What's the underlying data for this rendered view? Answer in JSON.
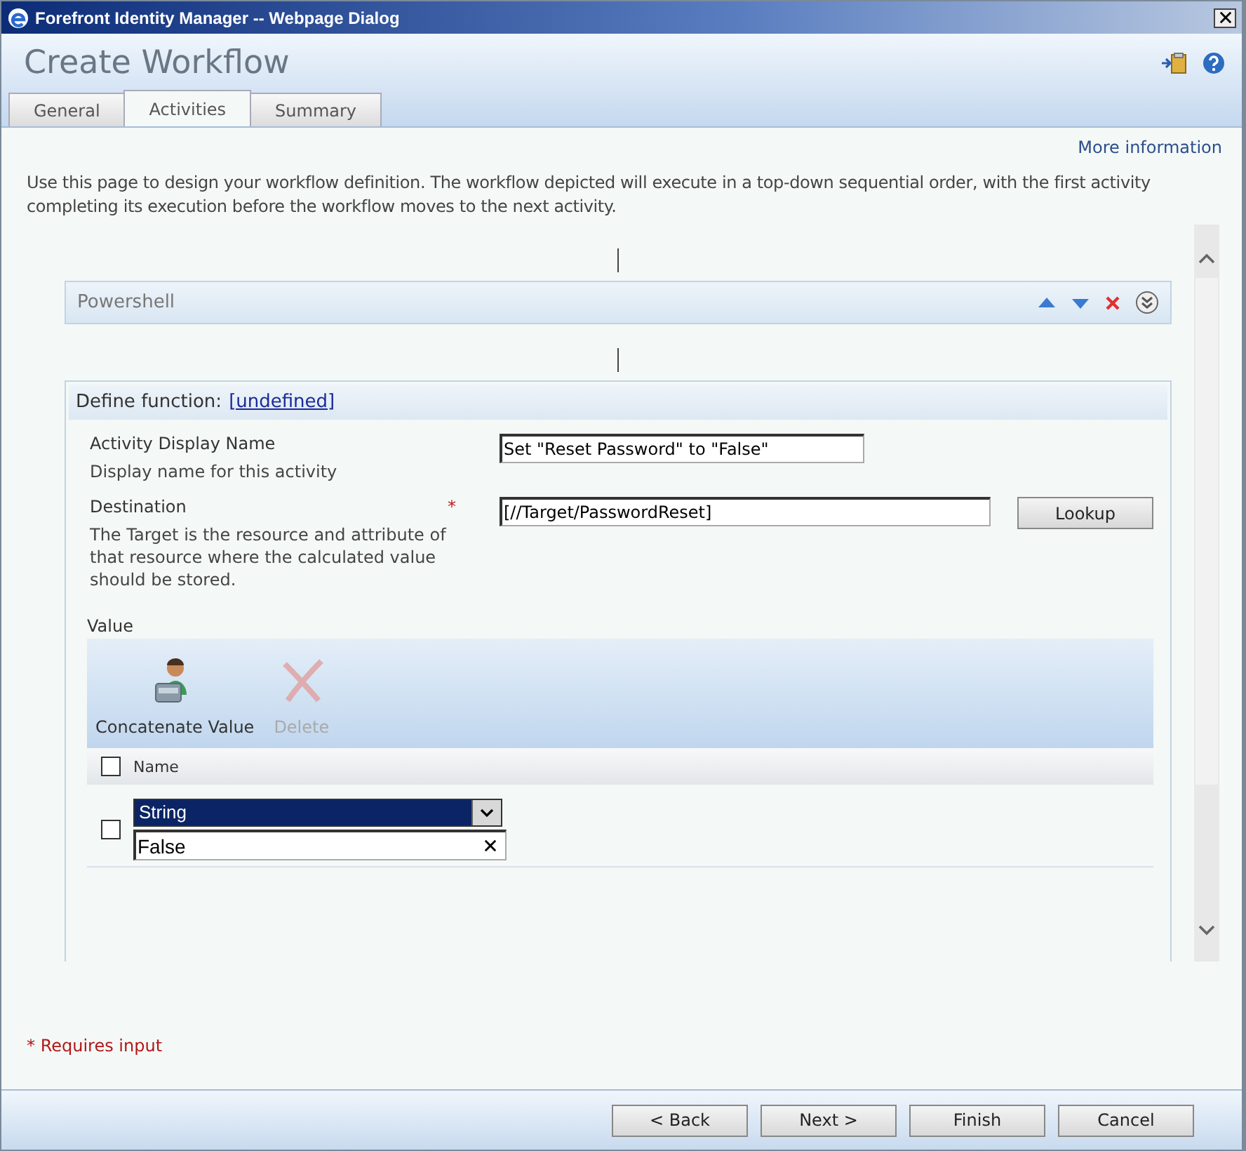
{
  "window": {
    "title": "Forefront Identity Manager -- Webpage Dialog"
  },
  "header": {
    "title": "Create Workflow"
  },
  "tabs": [
    {
      "label": "General",
      "selected": false
    },
    {
      "label": "Activities",
      "selected": true
    },
    {
      "label": "Summary",
      "selected": false
    }
  ],
  "more_info_link": "More information",
  "intro": "Use this page to design your workflow definition. The workflow depicted will execute in a top-down sequential order, with the first activity completing its execution before the workflow moves to the next activity.",
  "activity": {
    "title": "Powershell"
  },
  "define": {
    "label": "Define function:",
    "link": "[undefined]"
  },
  "fields": [
    {
      "label": "Activity Display Name",
      "hint": "Display name for this activity",
      "value": "Set \"Reset Password\" to \"False\""
    },
    {
      "label": "Destination",
      "hint": "The Target is the resource and attribute of that resource where the calculated value should be stored.",
      "value": "[//Target/PasswordReset]",
      "required_marker": "*",
      "button": "Lookup"
    }
  ],
  "value_section": {
    "label": "Value",
    "toolbar": [
      {
        "label": "Concatenate Value",
        "disabled": false,
        "kind": "person"
      },
      {
        "label": "Delete",
        "disabled": true,
        "kind": "delete"
      }
    ],
    "header": {
      "label": "Name",
      "checked": false
    },
    "rows": [
      {
        "checked": false,
        "type": "String",
        "value": "False"
      }
    ]
  },
  "required_note": "* Requires input",
  "buttons": [
    "< Back",
    "Next >",
    "Finish",
    "Cancel"
  ]
}
